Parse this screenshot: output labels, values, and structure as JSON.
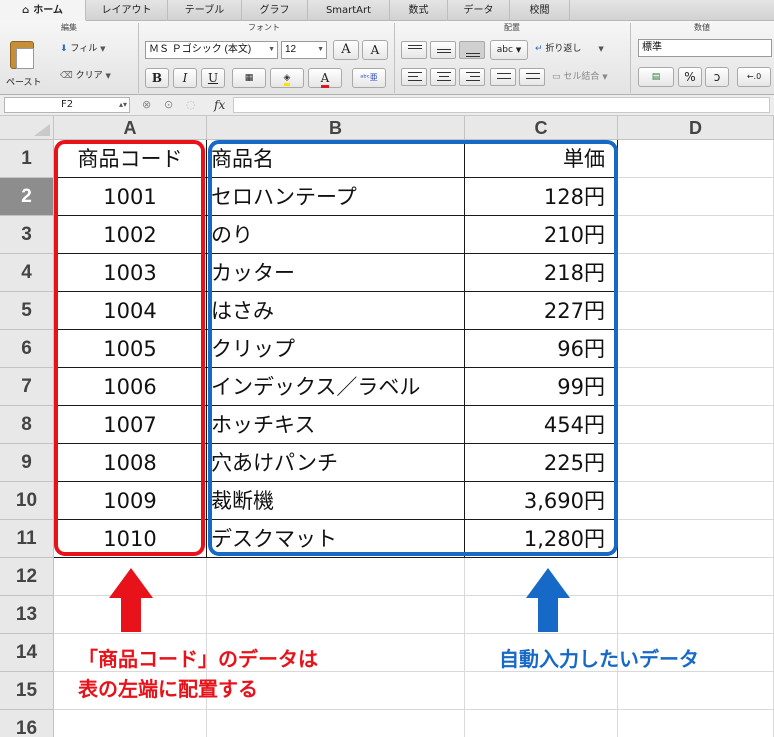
{
  "ribbon": {
    "tabs": [
      "ホーム",
      "レイアウト",
      "テーブル",
      "グラフ",
      "SmartArt",
      "数式",
      "データ",
      "校閲"
    ],
    "groups": {
      "edit": "編集",
      "font": "フォント",
      "align": "配置",
      "number": "数値"
    },
    "paste_label": "ペースト",
    "fill_label": "フィル",
    "clear_label": "クリア",
    "font_name": "ＭＳ Ｐゴシック (本文)",
    "font_size": "12",
    "grow_font": "A",
    "shrink_font": "A",
    "bold": "B",
    "italic": "I",
    "underline": "U",
    "font_color_glyph": "A",
    "rotate_text": "abc",
    "wrap_label": "折り返し",
    "merge_label": "セル結合",
    "number_format": "標準",
    "percent": "%",
    "comma": "₃",
    "decimal": "←.0"
  },
  "formula_bar": {
    "cell_ref": "F2",
    "fx": "fx",
    "formula": ""
  },
  "sheet": {
    "columns": [
      "A",
      "B",
      "C",
      "D"
    ],
    "rows": [
      "1",
      "2",
      "3",
      "4",
      "5",
      "6",
      "7",
      "8",
      "9",
      "10",
      "11",
      "12",
      "13",
      "14",
      "15",
      "16"
    ],
    "selected_row": "2",
    "header": {
      "code": "商品コード",
      "name": "商品名",
      "price": "単価"
    },
    "data": [
      {
        "code": "1001",
        "name": "セロハンテープ",
        "price": "128円"
      },
      {
        "code": "1002",
        "name": "のり",
        "price": "210円"
      },
      {
        "code": "1003",
        "name": "カッター",
        "price": "218円"
      },
      {
        "code": "1004",
        "name": "はさみ",
        "price": "227円"
      },
      {
        "code": "1005",
        "name": "クリップ",
        "price": "96円"
      },
      {
        "code": "1006",
        "name": "インデックス／ラベル",
        "price": "99円"
      },
      {
        "code": "1007",
        "name": "ホッチキス",
        "price": "454円"
      },
      {
        "code": "1008",
        "name": "穴あけパンチ",
        "price": "225円"
      },
      {
        "code": "1009",
        "name": "裁断機",
        "price": "3,690円"
      },
      {
        "code": "1010",
        "name": "デスクマット",
        "price": "1,280円"
      }
    ]
  },
  "annotations": {
    "red_line1": "「商品コード」のデータは",
    "red_line2": "表の左端に配置する",
    "blue_line1": "自動入力したいデータ",
    "red_color": "#e8131a",
    "blue_color": "#1769c7"
  }
}
